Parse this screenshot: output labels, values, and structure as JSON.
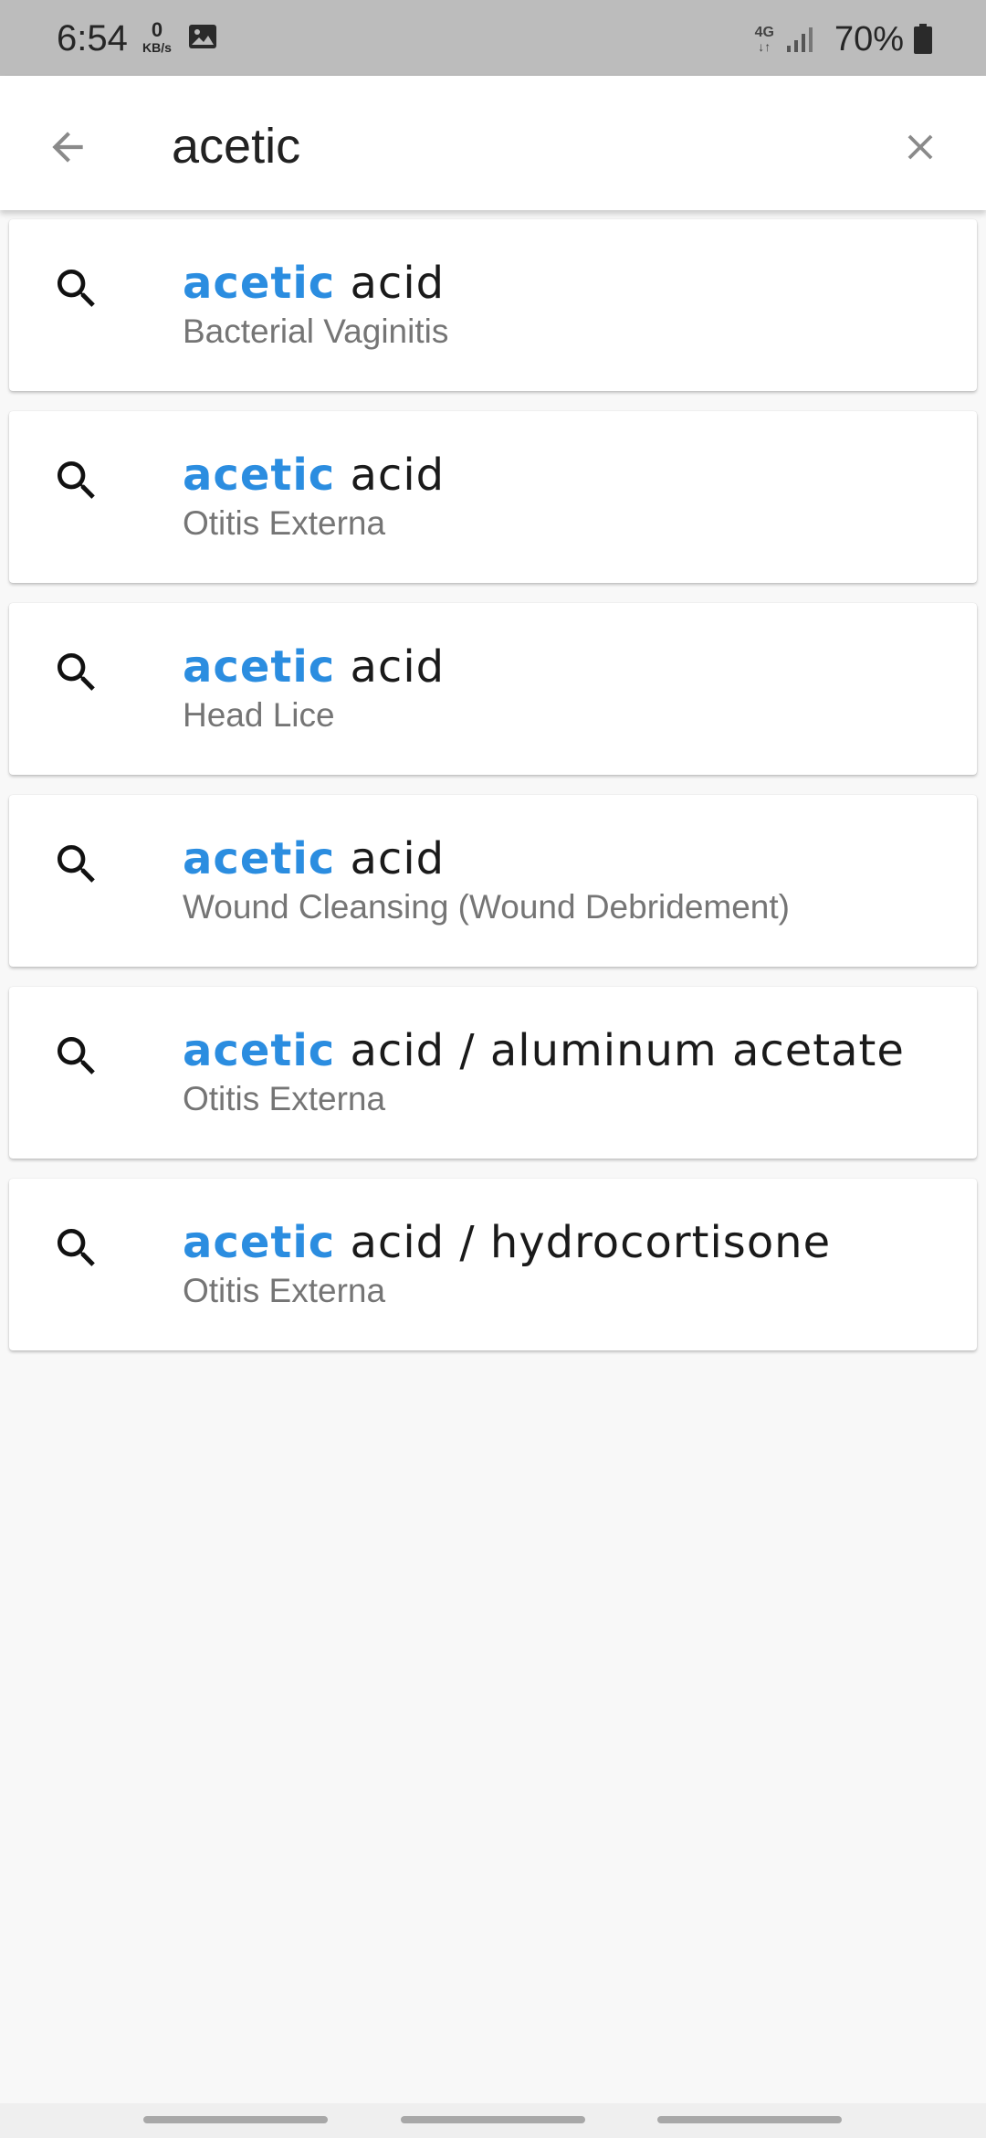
{
  "status_bar": {
    "time": "6:54",
    "net_speed_value": "0",
    "net_speed_unit": "KB/s",
    "network_type": "4G",
    "network_arrows": "↓↑",
    "battery": "70%",
    "icons": [
      "image-notification-icon",
      "signal-icon",
      "battery-icon"
    ]
  },
  "search": {
    "query": "acetic",
    "back_icon": "arrow-back-icon",
    "clear_icon": "close-icon"
  },
  "colors": {
    "highlight": "#2b8de0",
    "subtitle": "#757575",
    "background": "#f8f8f8"
  },
  "results": [
    {
      "match": "acetic",
      "rest": "acid",
      "subtitle": "Bacterial Vaginitis"
    },
    {
      "match": "acetic",
      "rest": "acid",
      "subtitle": "Otitis Externa"
    },
    {
      "match": "acetic",
      "rest": "acid",
      "subtitle": "Head Lice"
    },
    {
      "match": "acetic",
      "rest": "acid",
      "subtitle": "Wound Cleansing (Wound Debridement)"
    },
    {
      "match": "acetic",
      "rest": "acid / aluminum acetate",
      "subtitle": "Otitis Externa"
    },
    {
      "match": "acetic",
      "rest": "acid / hydrocortisone",
      "subtitle": "Otitis Externa"
    }
  ]
}
